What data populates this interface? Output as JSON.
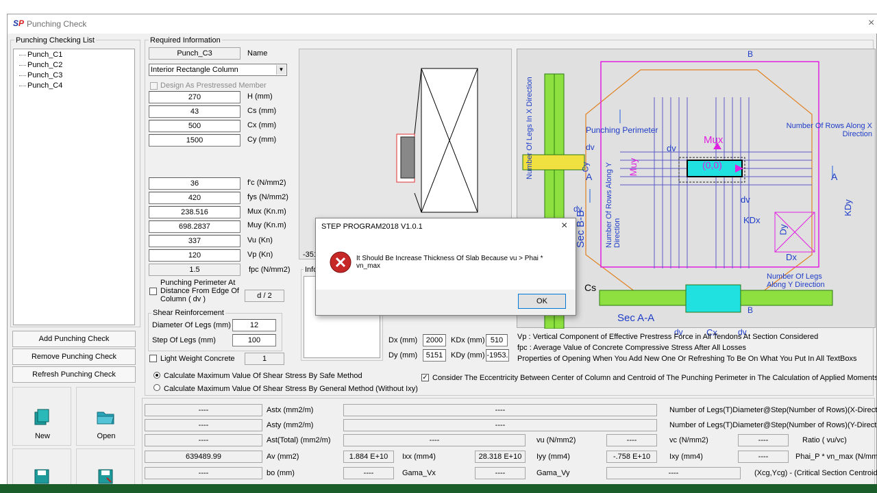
{
  "window": {
    "title": "Punching Check",
    "logo": "SP",
    "close_glyph": "×"
  },
  "list": {
    "group_title": "Punching Checking List",
    "items": [
      "Punch_C1",
      "Punch_C2",
      "Punch_C3",
      "Punch_C4"
    ]
  },
  "buttons": {
    "add": "Add Punching Check",
    "remove": "Remove Punching Check",
    "refresh": "Refresh Punching Check",
    "new": "New",
    "open": "Open"
  },
  "required": {
    "group_title": "Required Information",
    "name_value": "Punch_C3",
    "name_label": "Name",
    "column_type": "Interior Rectangle Column",
    "prestressed_label": "Design As Prestressed Member",
    "fields": [
      {
        "value": "270",
        "label": "H (mm)"
      },
      {
        "value": "43",
        "label": "Cs (mm)"
      },
      {
        "value": "500",
        "label": "Cx (mm)"
      },
      {
        "value": "1500",
        "label": "Cy (mm)"
      }
    ],
    "fields2": [
      {
        "value": "36",
        "label": "f'c (N/mm2)"
      },
      {
        "value": "420",
        "label": "fys (N/mm2)"
      },
      {
        "value": "238.516",
        "label": "Mux (Kn.m)"
      },
      {
        "value": "698.2837",
        "label": "Muy (Kn.m)"
      },
      {
        "value": "337",
        "label": "Vu (Kn)"
      },
      {
        "value": "120",
        "label": "Vp (Kn)"
      },
      {
        "value": "1.5",
        "label": "fpc (N/mm2)"
      }
    ],
    "perimeter_label": "Punching Perimeter At Distance From Edge Of Column ( dv )",
    "perimeter_value": "d / 2",
    "shear_title": "Shear Reinforcement",
    "diameter_label": "Diameter Of Legs (mm)",
    "diameter_value": "12",
    "step_label": "Step Of Legs (mm)",
    "step_value": "100",
    "light_label": "Light Weight Concrete",
    "light_value": "1"
  },
  "middle": {
    "partial_neg": "-351",
    "info_label": "Info",
    "dx_label": "Dx (mm)",
    "dx_value": "2000",
    "kdx_label": "KDx (mm)",
    "kdx_value": "510",
    "dy_label": "Dy (mm)",
    "dy_value": "5151",
    "kdy_label": "KDy (mm)",
    "kdy_value": "-1953."
  },
  "diagram": {
    "punching_perimeter": "Punching Perimeter",
    "mux": "Mux",
    "muy": "Muy",
    "center": "(0,0)",
    "rows_x": "Number Of Rows Along X Direction",
    "rows_y": "Number Of Rows Along Y Direction",
    "legs_x": "Number Of Legs In X Direction",
    "legs_y": "Number Of Legs Along Y Direction",
    "sec_aa": "Sec A-A",
    "sec_bb": "Sec B-B",
    "labels": {
      "a": "A",
      "b": "B",
      "dv": "dv",
      "cx": "Cx",
      "cy": "Cy",
      "cs": "Cs",
      "dx": "Dx",
      "dy": "Dy",
      "kdx": "KDx",
      "kdy": "KDy"
    }
  },
  "notes": [
    "Vp : Vertical Component of Effective Prestress Force in All Tendons At Section Considered",
    "fpc : Average Value of Concrete Compressive Stress After All Losses",
    "Properties of Opening When You Add New One Or Refreshing To Be  On What You Put In All TextBoxs"
  ],
  "options": {
    "safe": "Calculate Maximum Value Of  Shear Stress By Safe Method",
    "general": "Calculate Maximum Value Of  Shear Stress By General Method (Without Ixy)",
    "eccentricity": "Consider The Eccentricity Between Center of Column and Centroid of The Punching Perimeter in The Calculation of Applied Moments"
  },
  "results": {
    "dash": "----",
    "astx": "Astx (mm2/m)",
    "asty": "Asty (mm2/m)",
    "ast_total": "Ast(Total) (mm2/m)",
    "av": "Av (mm2)",
    "av_value": "639489.99",
    "bo": "bo (mm)",
    "ixx": "Ixx (mm4)",
    "ixx_value": "1.884 E+10",
    "iyy": "Iyy (mm4)",
    "iyy_value": "28.318 E+10",
    "ixy": "Ixy (mm4)",
    "ixy_value": "-.758 E+10",
    "vu": "vu (N/mm2)",
    "vc": "vc (N/mm2)",
    "gama_vx": "Gama_Vx",
    "gama_vy": "Gama_Vy",
    "legs_x": "Number of Legs(T)Diameter@Step(Number of Rows)(X-Direction)",
    "legs_y": "Number of Legs(T)Diameter@Step(Number of Rows)(Y-Direction)",
    "ratio": "Ratio ( vu/vc)",
    "phai": "Phai_P * vn_max (N/mm2)",
    "centroid": "(Xcg,Ycg) - (Critical Section Centroid)"
  },
  "dialog": {
    "title": "STEP PROGRAM2018 V1.0.1",
    "message": "It Should Be Increase Thickness Of Slab Because vu > Phai * vn_max",
    "ok": "OK",
    "close": "×"
  }
}
